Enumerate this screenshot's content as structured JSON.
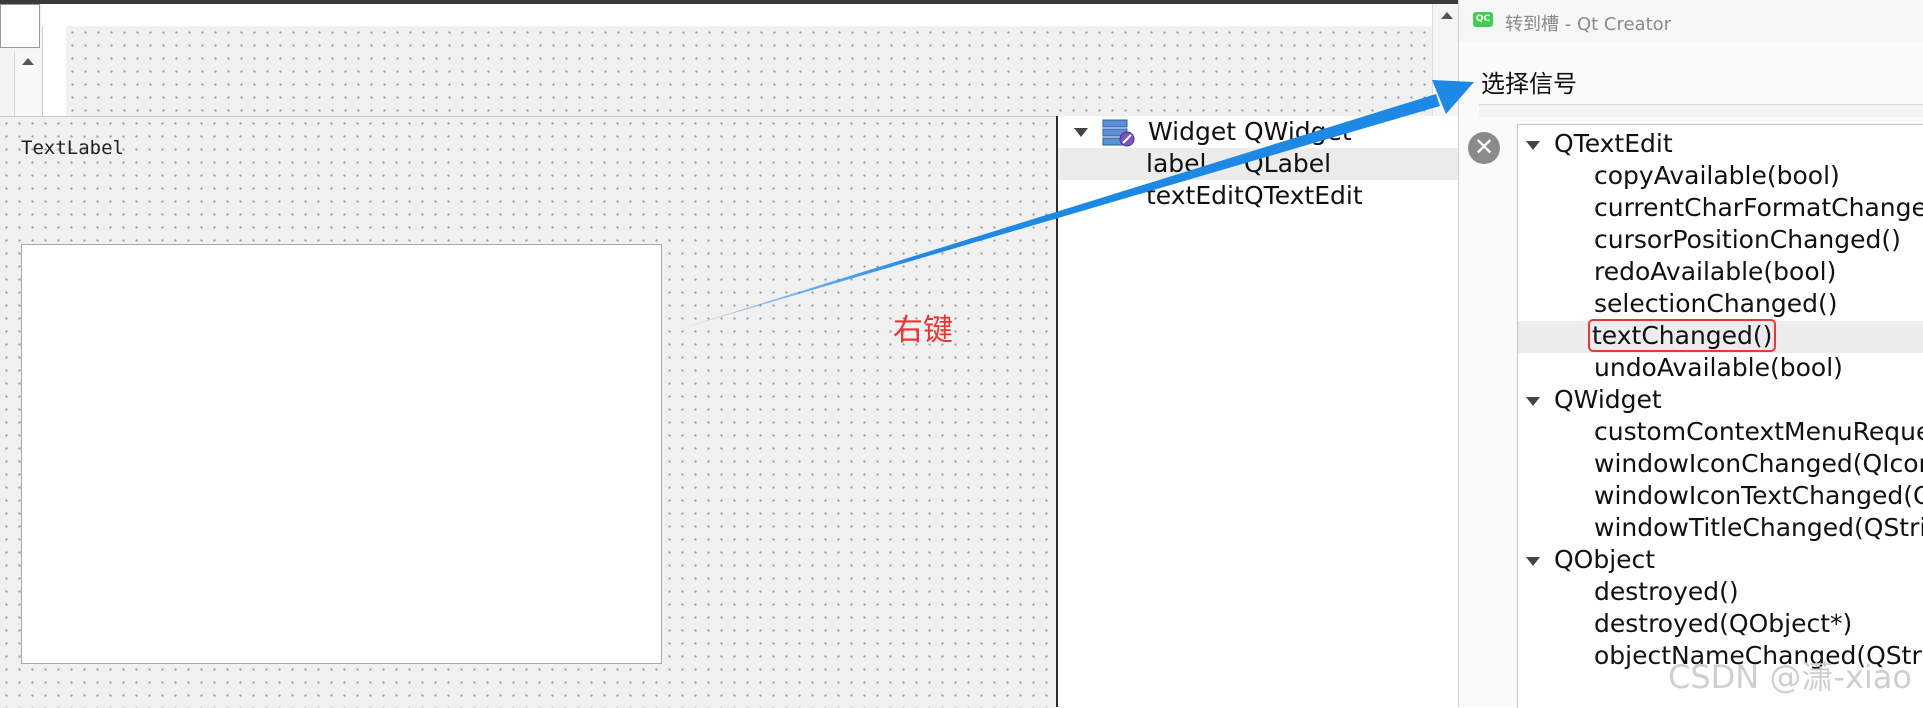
{
  "form": {
    "text_label": "TextLabel"
  },
  "annotation": {
    "right_click_note": "右键"
  },
  "object_inspector": {
    "rows": [
      {
        "object": "Widget",
        "class": "QWidget"
      },
      {
        "object": "label",
        "class": "QLabel"
      },
      {
        "object": "textEdit",
        "class": "QTextEdit"
      }
    ],
    "close_glyph": "✕"
  },
  "dialog": {
    "title": "转到槽 - Qt Creator",
    "app_icon_text": "QC",
    "prompt": "选择信号",
    "groups": [
      {
        "name": "QTextEdit",
        "signals": [
          "copyAvailable(bool)",
          "currentCharFormatChanged(",
          "cursorPositionChanged()",
          "redoAvailable(bool)",
          "selectionChanged()",
          "textChanged()",
          "undoAvailable(bool)"
        ]
      },
      {
        "name": "QWidget",
        "signals": [
          "customContextMenuRequest",
          "windowIconChanged(QIcon)",
          "windowIconTextChanged(QS",
          "windowTitleChanged(QString"
        ]
      },
      {
        "name": "QObject",
        "signals": [
          "destroyed()",
          "destroyed(QObject*)",
          "objectNameChanged(QString"
        ]
      }
    ],
    "selected_signal": "textChanged()"
  },
  "watermark": "CSDN @潇-xiao",
  "colors": {
    "arrow": "#1e88e5",
    "highlight_box": "#e53935",
    "annotation": "#e83535"
  }
}
